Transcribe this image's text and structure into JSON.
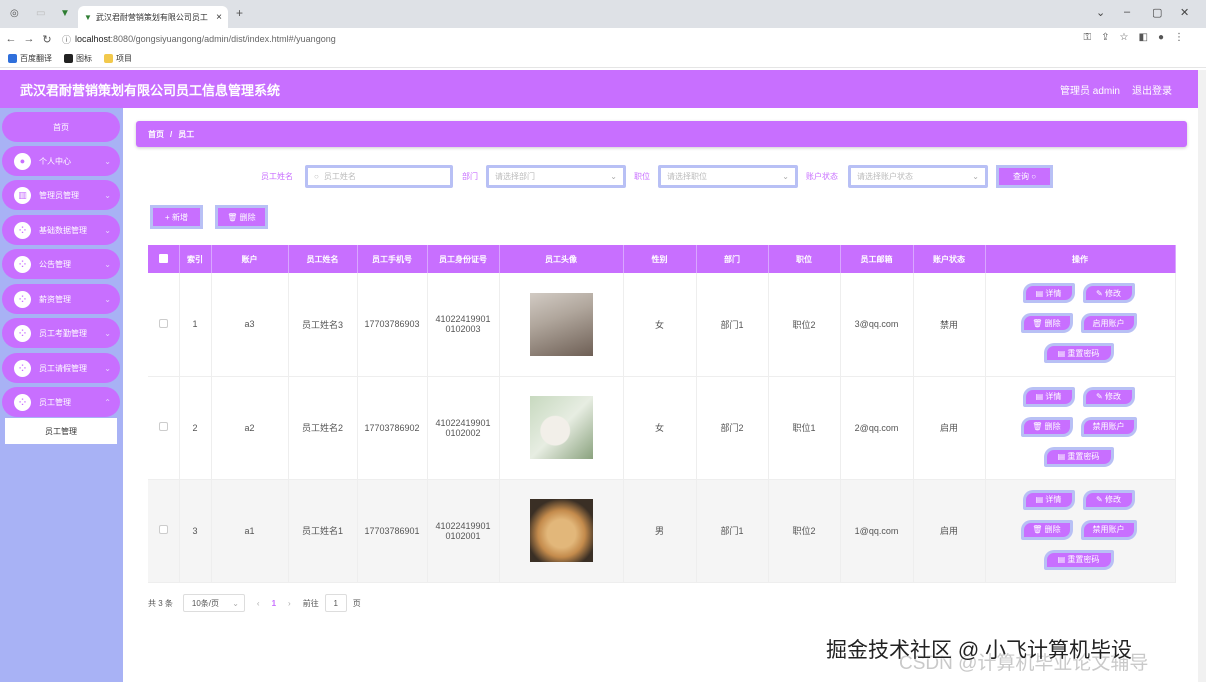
{
  "browser": {
    "tab_title": "武汉君耐营销策划有限公司员工",
    "tab_close": "×",
    "new_tab": "+",
    "url_domain": "localhost",
    "url_rest": ":8080/gongsiyuangong/admin/dist/index.html#/yuangong",
    "bookmarks": [
      "百度翻译",
      "图标",
      "项目"
    ]
  },
  "header": {
    "title": "武汉君耐营销策划有限公司员工信息管理系统",
    "admin": "管理员 admin",
    "logout": "退出登录"
  },
  "sidebar": {
    "items": [
      {
        "label": "首页"
      },
      {
        "label": "个人中心"
      },
      {
        "label": "管理员管理"
      },
      {
        "label": "基础数据管理"
      },
      {
        "label": "公告管理"
      },
      {
        "label": "薪资管理"
      },
      {
        "label": "员工考勤管理"
      },
      {
        "label": "员工请假管理"
      },
      {
        "label": "员工管理"
      }
    ],
    "sub_item": "员工管理"
  },
  "breadcrumb": {
    "home": "首页",
    "sep": "/",
    "current": "员工"
  },
  "search": {
    "name_label": "员工姓名",
    "name_placeholder": "员工姓名",
    "dept_label": "部门",
    "dept_placeholder": "请选择部门",
    "pos_label": "职位",
    "pos_placeholder": "请选择职位",
    "status_label": "账户状态",
    "status_placeholder": "请选择账户状态",
    "query_button": "查询 ○"
  },
  "actions": {
    "add": "+ 新增",
    "delete": "🗑 删除"
  },
  "table": {
    "headers": [
      "索引",
      "账户",
      "员工姓名",
      "员工手机号",
      "员工身份证号",
      "员工头像",
      "性别",
      "部门",
      "职位",
      "员工邮箱",
      "账户状态",
      "操作"
    ],
    "rows": [
      {
        "index": "1",
        "account": "a3",
        "name": "员工姓名3",
        "phone": "17703786903",
        "id1": "41022419901",
        "id2": "0102003",
        "gender": "女",
        "dept": "部门1",
        "pos": "职位2",
        "email": "3@qq.com",
        "status": "禁用",
        "toggle": "启用账户"
      },
      {
        "index": "2",
        "account": "a2",
        "name": "员工姓名2",
        "phone": "17703786902",
        "id1": "41022419901",
        "id2": "0102002",
        "gender": "女",
        "dept": "部门2",
        "pos": "职位1",
        "email": "2@qq.com",
        "status": "启用",
        "toggle": "禁用账户"
      },
      {
        "index": "3",
        "account": "a1",
        "name": "员工姓名1",
        "phone": "17703786901",
        "id1": "41022419901",
        "id2": "0102001",
        "gender": "男",
        "dept": "部门1",
        "pos": "职位2",
        "email": "1@qq.com",
        "status": "启用",
        "toggle": "禁用账户"
      }
    ],
    "op_detail": "▤ 详情",
    "op_edit": "✎ 修改",
    "op_delete": "🗑 删除",
    "op_reset": "▤ 重置密码"
  },
  "pager": {
    "total": "共 3 条",
    "size": "10条/页",
    "prev": "‹",
    "page": "1",
    "next": "›",
    "goto": "前往",
    "goto_val": "1",
    "unit": "页"
  },
  "watermark": {
    "line1": "掘金技术社区 @ 小飞计算机毕设",
    "line2": "CSDN @计算机毕业论文辅导"
  }
}
